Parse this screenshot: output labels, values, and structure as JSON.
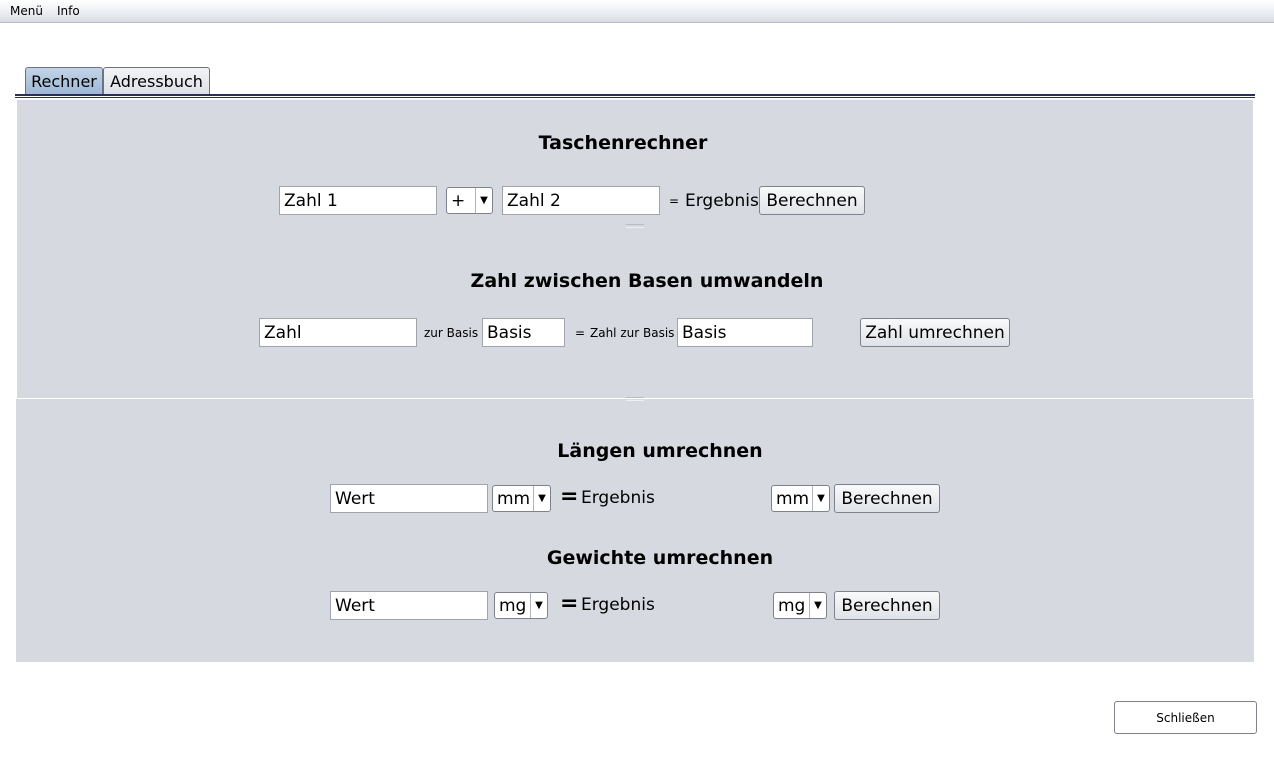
{
  "menubar": {
    "items": [
      "Menü",
      "Info"
    ]
  },
  "tabs": [
    {
      "label": "Rechner"
    },
    {
      "label": "Adressbuch"
    }
  ],
  "calculator": {
    "title": "Taschenrechner",
    "number1": "Zahl 1",
    "operator": "+",
    "number2": "Zahl 2",
    "equals": "=",
    "result": "Ergebnis",
    "button": "Berechnen"
  },
  "base_converter": {
    "title": "Zahl zwischen Basen umwandeln",
    "number": "Zahl",
    "to_base_label": "zur Basis",
    "base_in": "Basis",
    "equals": "=",
    "number_to_base_label": "Zahl zur Basis",
    "base_out": "Basis",
    "button": "Zahl umrechnen"
  },
  "length_converter": {
    "title": "Längen umrechnen",
    "value": "Wert",
    "unit_from": "mm",
    "equals": "=",
    "result": "Ergebnis",
    "unit_to": "mm",
    "button": "Berechnen"
  },
  "weight_converter": {
    "title": "Gewichte umrechnen",
    "value": "Wert",
    "unit_from": "mg",
    "equals": "=",
    "result": "Ergebnis",
    "unit_to": "mg",
    "button": "Berechnen"
  },
  "footer": {
    "close_button": "Schließen"
  }
}
